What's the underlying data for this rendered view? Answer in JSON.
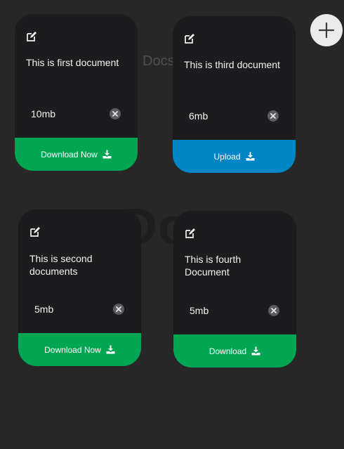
{
  "background": {
    "small_title": "Docs.",
    "large_title": "Docs."
  },
  "add_button": {
    "icon": "plus-icon",
    "color": "#ebebeb"
  },
  "colors": {
    "card_bg": "#1c1c1e",
    "green_footer": "#00a651",
    "blue_footer": "#0085c7",
    "page_bg": "#272728"
  },
  "cards": [
    {
      "title": "This is first document",
      "size": "10mb",
      "action_label": "Download Now",
      "action_color": "green",
      "icon": "download-icon"
    },
    {
      "title": "This is third document",
      "size": "6mb",
      "action_label": "Upload",
      "action_color": "blue",
      "icon": "download-icon"
    },
    {
      "title": "This is second documents",
      "size": "5mb",
      "action_label": "Download Now",
      "action_color": "green",
      "icon": "download-icon"
    },
    {
      "title": "This is fourth Document",
      "size": "5mb",
      "action_label": "Download",
      "action_color": "green",
      "icon": "download-icon"
    }
  ]
}
